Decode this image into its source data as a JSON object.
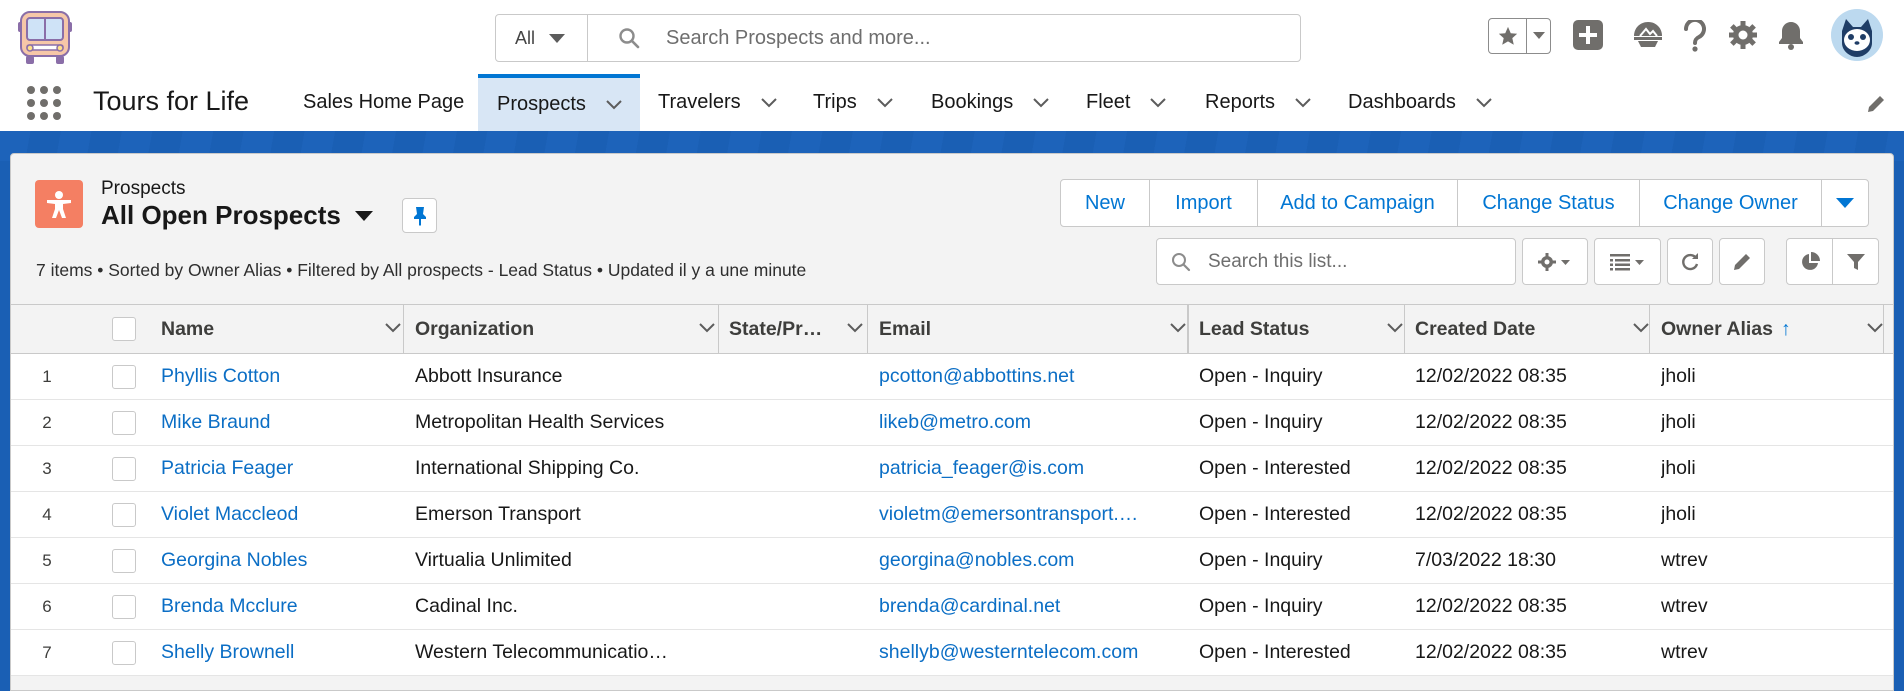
{
  "header": {
    "search_scope": "All",
    "search_placeholder": "Search Prospects and more..."
  },
  "nav": {
    "app_name": "Tours for Life",
    "items": [
      {
        "label": "Sales Home Page"
      },
      {
        "label": "Prospects"
      },
      {
        "label": "Travelers"
      },
      {
        "label": "Trips"
      },
      {
        "label": "Bookings"
      },
      {
        "label": "Fleet"
      },
      {
        "label": "Reports"
      },
      {
        "label": "Dashboards"
      }
    ]
  },
  "list_view": {
    "object_label": "Prospects",
    "title": "All Open Prospects",
    "meta": "7 items • Sorted by Owner Alias • Filtered by All prospects - Lead Status • Updated il y a une minute",
    "actions": [
      "New",
      "Import",
      "Add to Campaign",
      "Change Status",
      "Change Owner"
    ],
    "search_placeholder": "Search this list..."
  },
  "table": {
    "columns": [
      "Name",
      "Organization",
      "State/Pr…",
      "Email",
      "Lead Status",
      "Created Date",
      "Owner Alias"
    ],
    "sorted_column_indicator": "↑",
    "rows": [
      {
        "n": "1",
        "name": "Phyllis Cotton",
        "org": "Abbott Insurance",
        "state": "",
        "email": "pcotton@abbottins.net",
        "status": "Open - Inquiry",
        "created": "12/02/2022 08:35",
        "owner": "jholi"
      },
      {
        "n": "2",
        "name": "Mike Braund",
        "org": "Metropolitan Health Services",
        "state": "",
        "email": "likeb@metro.com",
        "status": "Open - Inquiry",
        "created": "12/02/2022 08:35",
        "owner": "jholi"
      },
      {
        "n": "3",
        "name": "Patricia Feager",
        "org": "International Shipping Co.",
        "state": "",
        "email": "patricia_feager@is.com",
        "status": "Open - Interested",
        "created": "12/02/2022 08:35",
        "owner": "jholi"
      },
      {
        "n": "4",
        "name": "Violet Maccleod",
        "org": "Emerson Transport",
        "state": "",
        "email": "violetm@emersontransport.…",
        "status": "Open - Interested",
        "created": "12/02/2022 08:35",
        "owner": "jholi"
      },
      {
        "n": "5",
        "name": "Georgina Nobles",
        "org": "Virtualia Unlimited",
        "state": "",
        "email": "georgina@nobles.com",
        "status": "Open - Inquiry",
        "created": "7/03/2022 18:30",
        "owner": "wtrev"
      },
      {
        "n": "6",
        "name": "Brenda Mcclure",
        "org": "Cadinal Inc.",
        "state": "",
        "email": "brenda@cardinal.net",
        "status": "Open - Inquiry",
        "created": "12/02/2022 08:35",
        "owner": "wtrev"
      },
      {
        "n": "7",
        "name": "Shelly Brownell",
        "org": "Western Telecommunicatio…",
        "state": "",
        "email": "shellyb@westerntelecom.com",
        "status": "Open - Interested",
        "created": "12/02/2022 08:35",
        "owner": "wtrev"
      }
    ]
  },
  "colors": {
    "brand_blue": "#0176d3",
    "link": "#0b6ec5",
    "object_icon": "#f47f63",
    "band": "#1a5fb4"
  }
}
